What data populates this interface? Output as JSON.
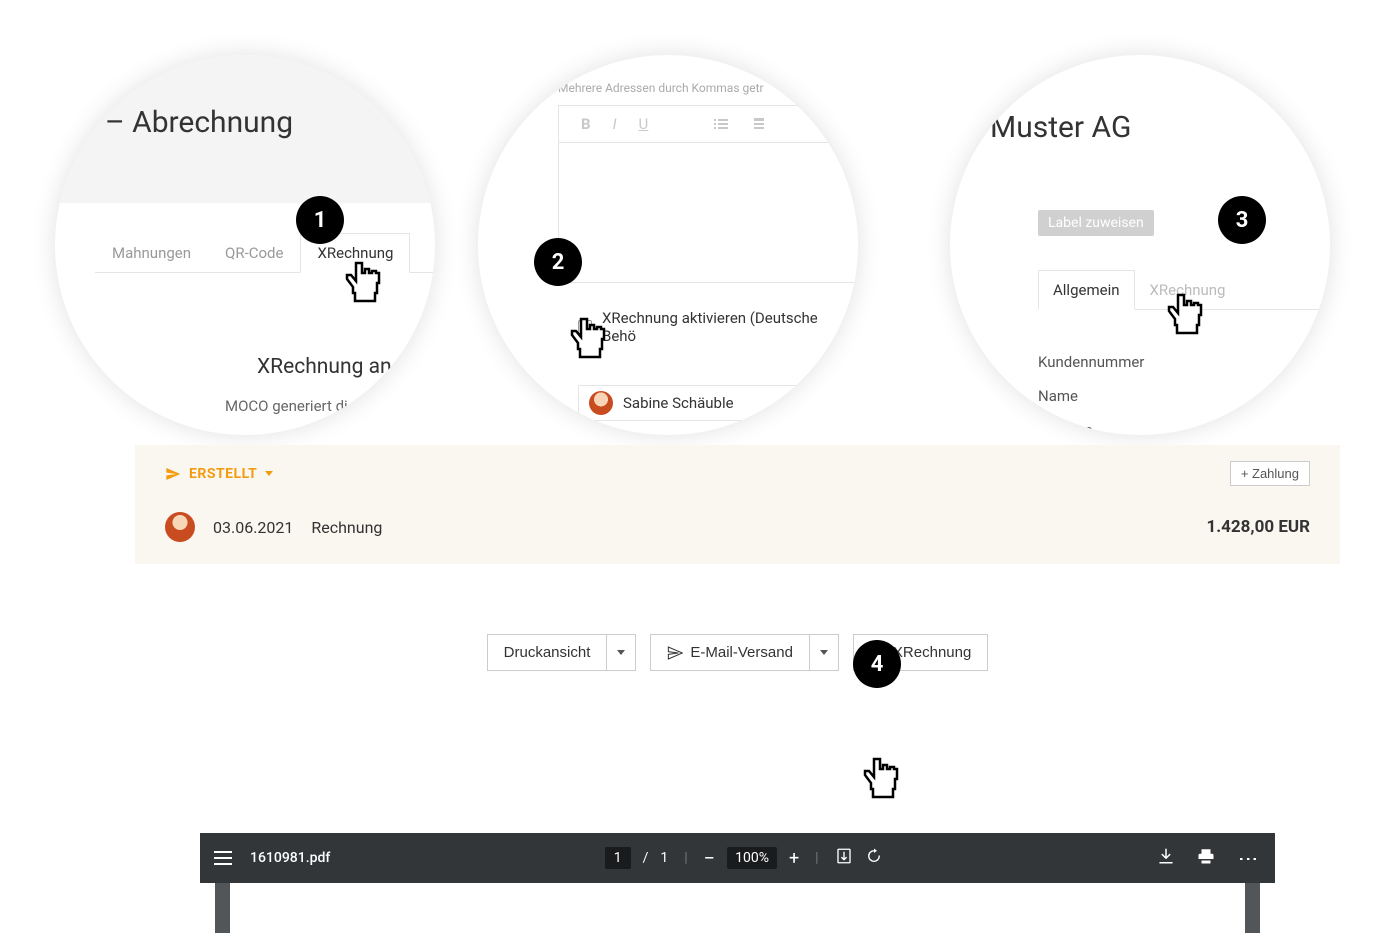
{
  "circle1": {
    "title": "– Abrechnung",
    "tabs": [
      "Mahnungen",
      "QR-Code",
      "XRechnung"
    ],
    "active_tab": 2,
    "body_title": "XRechnung an",
    "body_text": "MOCO generiert die"
  },
  "circle2": {
    "hint": "Mehrere Adressen durch Kommas getr",
    "toolbar": {
      "b": "B",
      "i": "I",
      "u": "U"
    },
    "checkbox_label": "XRechnung aktivieren (Deutsche Behö",
    "user_name": "Sabine Schäuble"
  },
  "circle3": {
    "title": "Muster AG",
    "label_btn": "Label zuweisen",
    "tabs": [
      "Allgemein",
      "XRechnung"
    ],
    "active_tab": 0,
    "fields": [
      "Kundennummer",
      "Name",
      "Adresse"
    ]
  },
  "badges": [
    "1",
    "2",
    "3",
    "4"
  ],
  "panel": {
    "status": "ERSTELLT",
    "payment_btn": "+ Zahlung",
    "date": "03.06.2021",
    "doc_type": "Rechnung",
    "amount": "1.428,00 EUR",
    "actions": {
      "print": "Druckansicht",
      "email": "E-Mail-Versand",
      "xrechnung": "XRechnung"
    }
  },
  "pdf": {
    "filename": "1610981.pdf",
    "page_current": "1",
    "page_sep": "/",
    "page_total": "1",
    "zoom": "100%"
  }
}
